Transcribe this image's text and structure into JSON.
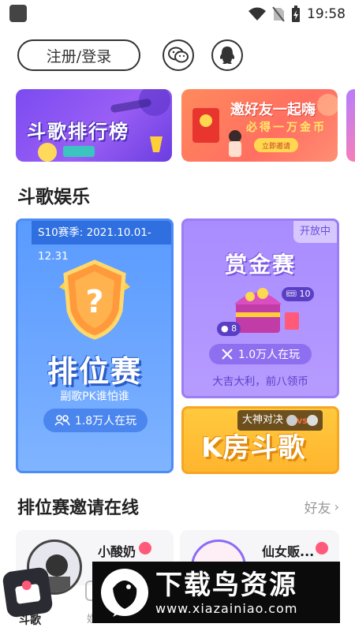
{
  "status_bar": {
    "time": "19:58",
    "icons": [
      "wifi-icon",
      "no-sim-icon",
      "battery-charging-icon"
    ]
  },
  "top_bar": {
    "login_label": "注册/登录",
    "social_icons": [
      "wechat-icon",
      "qq-icon"
    ]
  },
  "banners": [
    {
      "title": "斗歌排行榜"
    },
    {
      "title": "邀好友一起嗨",
      "subtitle": "必得一万金币",
      "button": "立即邀请"
    }
  ],
  "section_title": "斗歌娱乐",
  "cards": {
    "rank": {
      "season": "S10赛季: 2021.10.01-12.31",
      "title": "排位赛",
      "subtitle": "副歌PK谁怕谁",
      "players": "1.8万人在玩"
    },
    "bounty": {
      "tag": "开放中",
      "title": "赏金赛",
      "ticket_count": "10",
      "coin_count": "8",
      "players": "1.0万人在玩",
      "desc": "大吉大利，前八领币"
    },
    "kroom": {
      "tag": "大神对决",
      "title": "K房斗歌"
    }
  },
  "invite_online": {
    "title": "排位赛邀请在线",
    "friends_link": "好友",
    "users": [
      {
        "name": "小酸奶"
      },
      {
        "name": "仙女贩..."
      }
    ]
  },
  "tab_bar": {
    "tabs": [
      {
        "label": "斗歌",
        "active": true
      },
      {
        "label": "娱乐",
        "active": false
      }
    ]
  },
  "watermark": {
    "text": "下载鸟资源",
    "url": "www.xiazainiao.com"
  },
  "colors": {
    "rank_blue": "#5a9bff",
    "bounty_purple": "#a98cff",
    "kroom_yellow": "#ffc93e",
    "accent_pink": "#ff5a7a"
  }
}
